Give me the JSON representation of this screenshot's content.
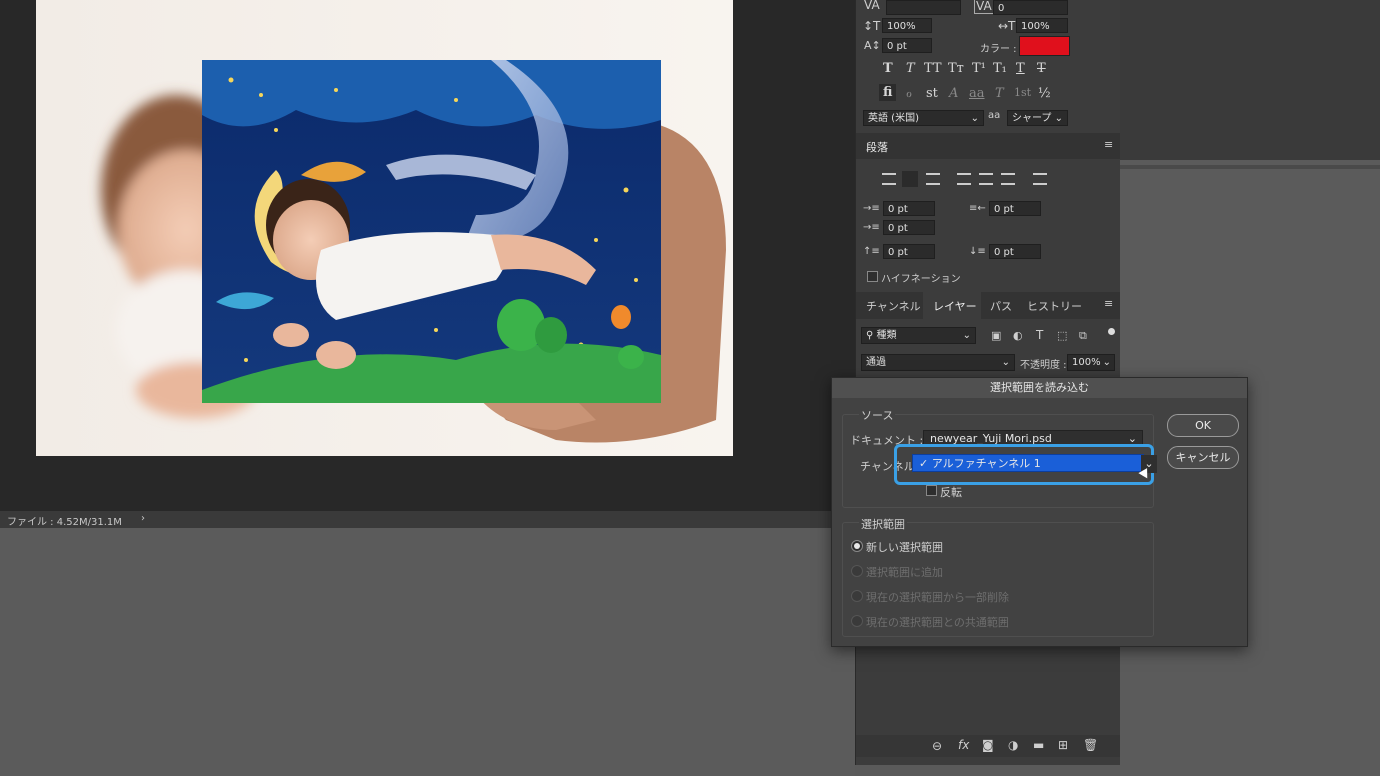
{
  "status_bar": {
    "file_info": "ファイル : 4.52M/31.1M",
    "arrow": "›"
  },
  "character_panel": {
    "kerning_label": "VA",
    "tracking_value": "0",
    "vertical_scale": "100%",
    "horizontal_scale": "100%",
    "baseline_shift": "0 pt",
    "color_label": "カラー :",
    "color_swatch": "#e0101c",
    "style_buttons": [
      "T",
      "T",
      "TT",
      "Tт",
      "T¹",
      "T₁",
      "T",
      "T"
    ],
    "opentype_buttons": [
      "fi",
      "ℴ",
      "st",
      "A",
      "aa",
      "T",
      "1st",
      "½"
    ],
    "language": "英語 (米国)",
    "aa_label": "aa",
    "antialias": "シャープ"
  },
  "paragraph_panel": {
    "title": "段落",
    "indent_left": "0 pt",
    "indent_right": "0 pt",
    "indent_first": "0 pt",
    "space_before": "0 pt",
    "space_after": "0 pt",
    "hyphenation_label": "ハイフネーション"
  },
  "layers_panel": {
    "tabs": [
      "チャンネル",
      "レイヤー",
      "パス",
      "ヒストリー"
    ],
    "active_tab": "レイヤー",
    "filter_kind": "種類",
    "blend_mode": "通過",
    "opacity_label": "不透明度 :",
    "opacity_value": "100%",
    "footer_icons": [
      "link-icon",
      "fx-icon",
      "mask-icon",
      "adjustment-icon",
      "folder-icon",
      "new-layer-icon",
      "trash-icon"
    ],
    "fx_label": "fx"
  },
  "dialog": {
    "title": "選択範囲を読み込む",
    "source_label": "ソース",
    "document_label": "ドキュメント :",
    "document_value": "newyear_Yuji Mori.psd",
    "channel_label": "チャンネル :",
    "channel_value": "✓ アルファチャンネル 1",
    "invert_label": "反転",
    "operation_label": "選択範囲",
    "operations": [
      {
        "label": "新しい選択範囲",
        "selected": true,
        "enabled": true
      },
      {
        "label": "選択範囲に追加",
        "selected": false,
        "enabled": false
      },
      {
        "label": "現在の選択範囲から一部削除",
        "selected": false,
        "enabled": false
      },
      {
        "label": "現在の選択範囲との共通範囲",
        "selected": false,
        "enabled": false
      }
    ],
    "ok_label": "OK",
    "cancel_label": "キャンセル",
    "highlight_color": "#3aa0e6"
  }
}
